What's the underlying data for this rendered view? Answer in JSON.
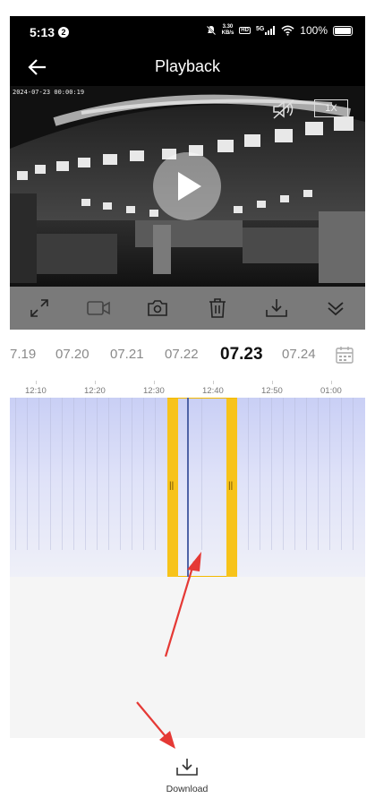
{
  "status_bar": {
    "time": "5:13",
    "notification_count": "2",
    "net_speed_value": "3.30",
    "net_speed_unit": "KB/s",
    "network_type": "5G",
    "battery": "100%"
  },
  "header": {
    "title": "Playback"
  },
  "video": {
    "timestamp": "2024-07-23 00:00:19",
    "speed": "1X"
  },
  "dates": {
    "items": [
      "7.19",
      "07.20",
      "07.21",
      "07.22",
      "07.23",
      "07.24"
    ],
    "selected": "07.23"
  },
  "timeline": {
    "ticks": [
      "12:10",
      "12:20",
      "12:30",
      "12:40",
      "12:50",
      "01:00"
    ]
  },
  "bottom": {
    "download_label": "Download"
  },
  "colors": {
    "accent": "#f7c31a",
    "arrow": "#e53935",
    "track": "#c9cff5"
  }
}
